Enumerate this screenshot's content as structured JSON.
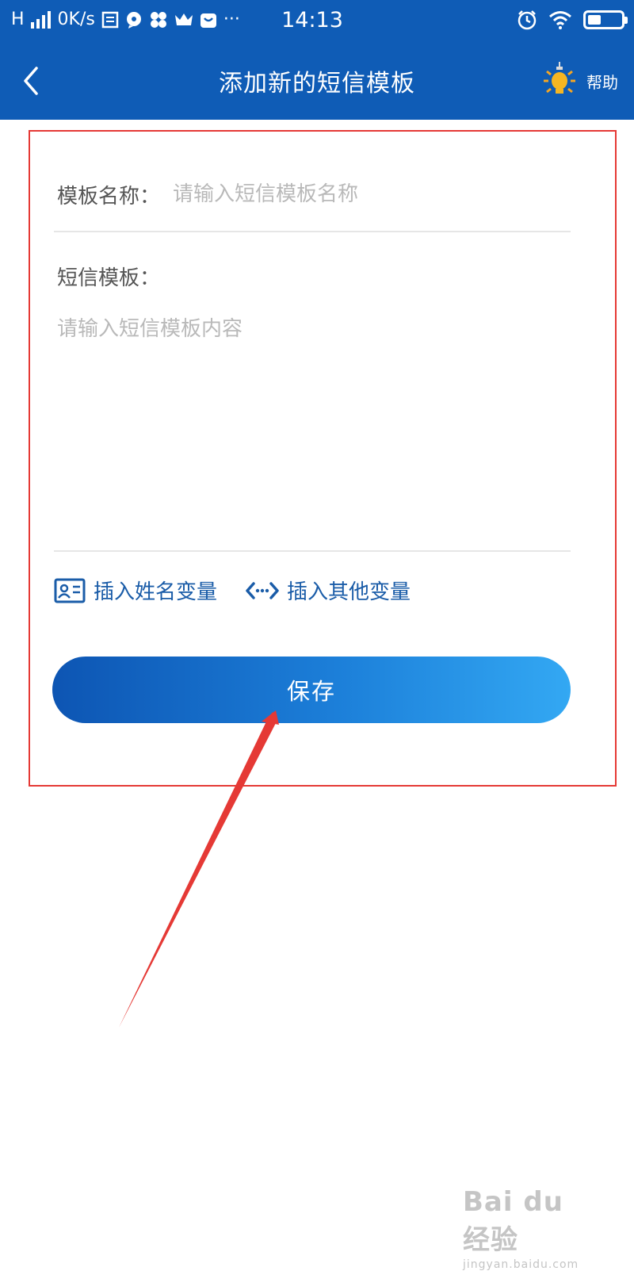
{
  "status_bar": {
    "signal_text": "H",
    "speed": "0K/s",
    "time": "14:13",
    "more_icons": "···",
    "battery_level": 0.4
  },
  "nav": {
    "title": "添加新的短信模板",
    "help_label": "帮助"
  },
  "form": {
    "name_label": "模板名称：",
    "name_placeholder": "请输入短信模板名称",
    "content_label": "短信模板：",
    "content_placeholder": "请输入短信模板内容",
    "insert_name_variable": "插入姓名变量",
    "insert_other_variable": "插入其他变量",
    "save_label": "保存"
  },
  "watermark": {
    "main": "Bai du 经验",
    "sub": "jingyan.baidu.com"
  },
  "colors": {
    "header_bg": "#0f5cb6",
    "link_blue": "#1a5ca8",
    "highlight_red": "#e53935",
    "button_gradient_start": "#0d55b3",
    "button_gradient_end": "#33a8f3"
  },
  "icons": {
    "back": "chevron-left-icon",
    "help": "lightbulb-icon",
    "insert_name": "id-card-icon",
    "insert_other": "code-brackets-icon"
  }
}
